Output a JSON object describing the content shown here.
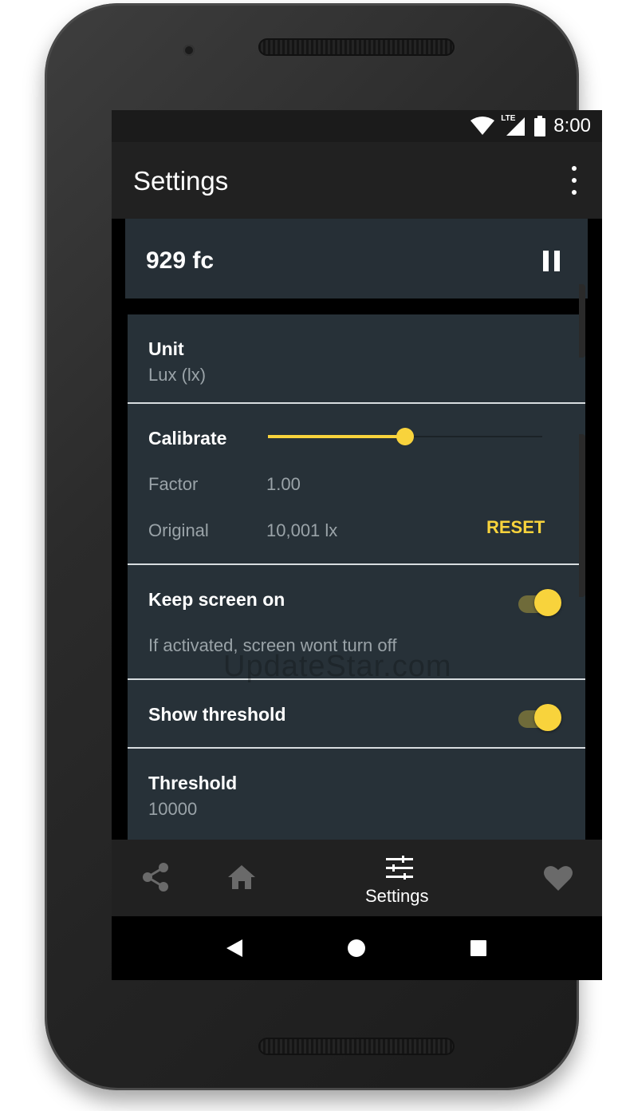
{
  "status_bar": {
    "time": "8:00",
    "network_label": "LTE",
    "icons": [
      "wifi-icon",
      "cellular-lte-icon",
      "battery-icon"
    ]
  },
  "toolbar": {
    "title": "Settings",
    "overflow_icon": "more-vert-icon"
  },
  "reading": {
    "value": "929 fc",
    "pause_icon": "pause-icon"
  },
  "settings": {
    "unit": {
      "title": "Unit",
      "value": "Lux (lx)"
    },
    "calibrate": {
      "title": "Calibrate",
      "slider_fraction": 0.5,
      "factor_label": "Factor",
      "factor_value": "1.00",
      "original_label": "Original",
      "original_value": "10,001 lx",
      "reset_label": "RESET"
    },
    "keep_screen_on": {
      "title": "Keep screen on",
      "description": "If activated, screen wont turn off",
      "enabled": true
    },
    "show_threshold": {
      "title": "Show threshold",
      "enabled": true
    },
    "threshold": {
      "title": "Threshold",
      "value": "10000"
    }
  },
  "bottom_nav": {
    "items": [
      {
        "icon": "share-icon",
        "label": ""
      },
      {
        "icon": "home-icon",
        "label": ""
      },
      {
        "icon": "tune-icon",
        "label": "Settings",
        "active": true
      },
      {
        "icon": "heart-icon",
        "label": ""
      }
    ]
  },
  "system_nav": {
    "icons": [
      "back-icon",
      "home-circle-icon",
      "recents-icon"
    ]
  },
  "watermark": "UpdateStar.com",
  "colors": {
    "accent": "#f8d33c",
    "card": "#273138",
    "reading_card": "#262f36",
    "toolbar": "#212121"
  }
}
